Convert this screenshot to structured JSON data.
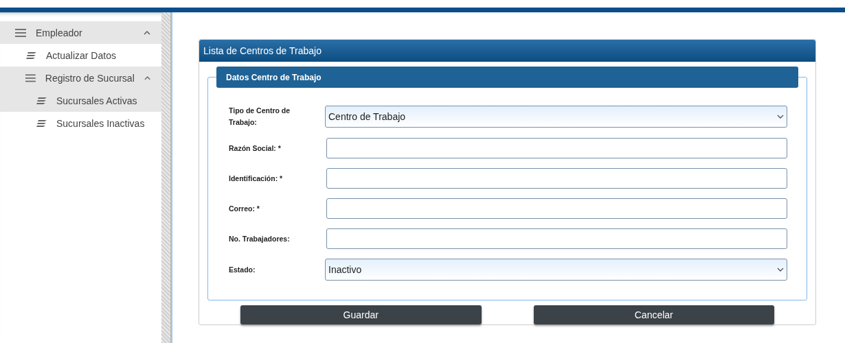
{
  "sidebar": {
    "items": [
      {
        "label": "Empleador",
        "expanded": true,
        "children": [
          {
            "label": "Actualizar Datos",
            "selected": false
          },
          {
            "label": "Registro de Sucursal",
            "expanded": true,
            "children": [
              {
                "label": "Sucursales Activas",
                "selected": true
              },
              {
                "label": "Sucursales Inactivas",
                "selected": false
              }
            ]
          }
        ]
      }
    ]
  },
  "panel": {
    "title": "Lista de Centros de Trabajo",
    "section": {
      "title": "Datos Centro de Trabajo",
      "fields": [
        {
          "kind": "select",
          "label": "Tipo de Centro de Trabajo:",
          "value": "Centro de Trabajo"
        },
        {
          "kind": "text",
          "label": "Razón Social: *"
        },
        {
          "kind": "text",
          "label": "Identificación: *"
        },
        {
          "kind": "text",
          "label": "Correo: *"
        },
        {
          "kind": "text",
          "label": "No. Trabajadores:"
        },
        {
          "kind": "select",
          "label": "Estado:",
          "value": "Inactivo"
        }
      ]
    },
    "buttons": [
      "Guardar",
      "Cancelar"
    ]
  }
}
